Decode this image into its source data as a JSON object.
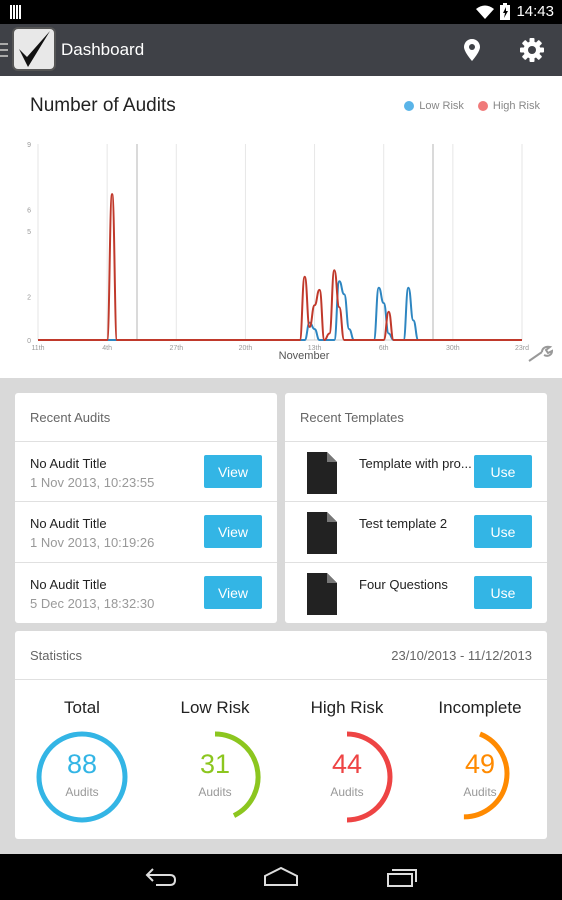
{
  "status_bar": {
    "time": "14:43",
    "icons": [
      "signal-bars-icon",
      "wifi-icon",
      "battery-icon"
    ]
  },
  "header": {
    "title": "Dashboard",
    "icons": [
      "app-logo-checkmark",
      "location-pin-icon",
      "settings-gear-icon"
    ]
  },
  "chart_data": {
    "type": "line",
    "title": "Number of Audits",
    "xlabel": "November",
    "ylabel": "",
    "x_tick_labels": [
      "11th",
      "4th",
      "27th",
      "20th",
      "13th",
      "6th",
      "30th",
      "23rd"
    ],
    "y_tick_labels": [
      "0",
      "2",
      "5",
      "6",
      "9"
    ],
    "grid": "vertical lines",
    "legend": "top-right",
    "series": [
      {
        "name": "Low Risk",
        "color": "#2e86c1",
        "values": [
          0,
          0,
          0,
          0,
          0,
          0,
          0,
          0,
          0,
          0,
          0,
          0,
          0,
          0,
          0,
          0,
          0,
          0,
          0,
          0,
          0,
          0,
          0,
          0,
          0,
          0,
          0,
          0,
          0,
          0,
          0,
          0,
          0,
          0,
          0,
          0,
          0,
          0,
          0,
          0,
          0,
          0,
          0,
          0,
          0,
          0,
          0,
          0,
          0,
          0,
          0,
          0,
          0,
          0,
          0,
          0.8,
          0.5,
          0,
          0,
          0,
          0,
          2.7,
          2.1,
          0.5,
          0,
          0,
          0,
          0,
          0,
          2.4,
          1.7,
          0.3,
          0,
          0,
          0,
          2.4,
          0.9,
          0,
          0,
          0,
          0,
          0,
          0,
          0,
          0,
          0,
          0,
          0,
          0,
          0,
          0,
          0,
          0,
          0,
          0,
          0,
          0,
          0,
          0
        ]
      },
      {
        "name": "High Risk",
        "color": "#c0392b",
        "values": [
          0,
          0,
          0,
          0,
          0,
          0,
          0,
          0,
          0,
          0,
          0,
          0,
          0,
          0,
          0,
          6.7,
          0,
          0,
          0,
          0,
          0,
          0,
          0,
          0,
          0,
          0,
          0,
          0,
          0,
          0,
          0,
          0,
          0,
          0,
          0,
          0,
          0,
          0,
          0,
          0,
          0,
          0,
          0,
          0,
          0,
          0,
          0,
          0,
          0,
          0,
          0,
          0,
          0,
          0,
          2.9,
          0.6,
          1.6,
          2.3,
          0,
          0.3,
          3.2,
          1.5,
          0,
          0,
          0,
          0,
          0,
          0,
          0,
          0,
          0,
          1.3,
          0,
          0,
          0,
          0,
          0,
          0,
          0,
          0,
          0,
          0,
          0,
          0,
          0,
          0,
          0,
          0,
          0,
          0,
          0,
          0,
          0,
          0,
          0,
          0,
          0,
          0,
          0
        ]
      }
    ]
  },
  "recent_audits": {
    "header": "Recent Audits",
    "button_label": "View",
    "items": [
      {
        "title": "No Audit Title",
        "date": "1 Nov 2013, 10:23:55"
      },
      {
        "title": "No Audit Title",
        "date": "1 Nov 2013, 10:19:26"
      },
      {
        "title": "No Audit Title",
        "date": "5 Dec 2013, 18:32:30"
      }
    ]
  },
  "recent_templates": {
    "header": "Recent Templates",
    "button_label": "Use",
    "items": [
      {
        "name": "Template with pro..."
      },
      {
        "name": "Test template 2"
      },
      {
        "name": "Four Questions"
      }
    ]
  },
  "statistics": {
    "header": "Statistics",
    "date_range": "23/10/2013 - 11/12/2013",
    "unit": "Audits",
    "items": [
      {
        "label": "Total",
        "value": "88",
        "fraction": 1.0,
        "color": "#33b5e5"
      },
      {
        "label": "Low Risk",
        "value": "31",
        "fraction": 0.35,
        "color": "#8cc61f"
      },
      {
        "label": "High Risk",
        "value": "44",
        "fraction": 0.5,
        "color": "#ee4444"
      },
      {
        "label": "Incomplete",
        "value": "49",
        "fraction": 0.56,
        "color": "#ff8a00"
      }
    ]
  },
  "nav_bar": {
    "icons": [
      "back-icon",
      "home-icon",
      "recent-apps-icon"
    ]
  }
}
